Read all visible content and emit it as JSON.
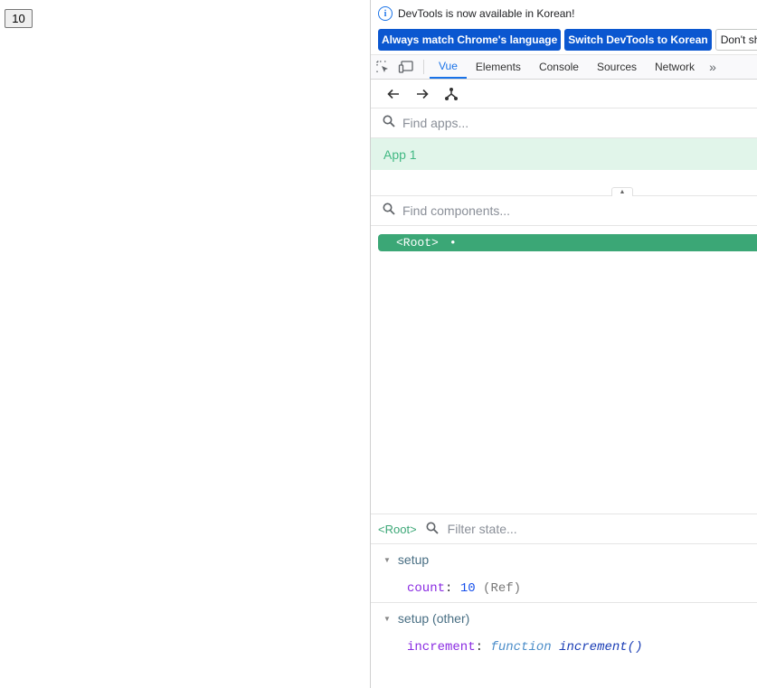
{
  "app": {
    "counter_value": "10"
  },
  "devtools": {
    "infobar": {
      "message": "DevTools is now available in Korean!"
    },
    "actions": {
      "match_language": "Always match Chrome's language",
      "switch_korean": "Switch DevTools to Korean",
      "dont_show": "Don't show"
    },
    "tabs": [
      "Vue",
      "Elements",
      "Console",
      "Sources",
      "Network"
    ],
    "apps_search": {
      "placeholder": "Find apps..."
    },
    "apps": [
      "App 1"
    ],
    "components_search": {
      "placeholder": "Find components..."
    },
    "tree": {
      "root_label": "<Root>",
      "root_dot": "•"
    },
    "state": {
      "selected": "<Root>",
      "filter_placeholder": "Filter state...",
      "sections": [
        {
          "title": "setup",
          "prop_key": "count",
          "prop_value": "10",
          "prop_extra": "(Ref)"
        },
        {
          "title": "setup (other)",
          "prop_key": "increment",
          "prop_keyword": "function",
          "prop_value": "increment()"
        }
      ]
    },
    "colors": {
      "vue_green": "#3ba776",
      "active_tab": "#1a73e8",
      "primary_button": "#0b57d0"
    }
  }
}
